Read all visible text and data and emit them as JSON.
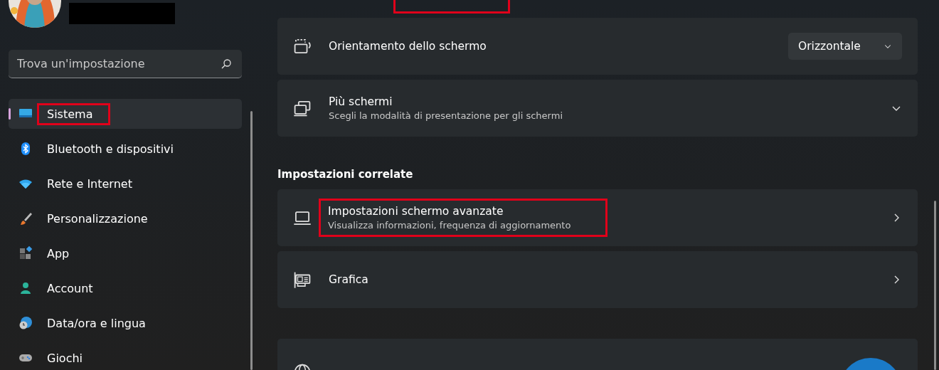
{
  "user": {
    "name_redacted": true
  },
  "search": {
    "placeholder": "Trova un'impostazione"
  },
  "sidebar": {
    "items": [
      {
        "label": "Sistema",
        "selected": true,
        "highlighted": true
      },
      {
        "label": "Bluetooth e dispositivi",
        "selected": false,
        "highlighted": false
      },
      {
        "label": "Rete e Internet",
        "selected": false,
        "highlighted": false
      },
      {
        "label": "Personalizzazione",
        "selected": false,
        "highlighted": false
      },
      {
        "label": "App",
        "selected": false,
        "highlighted": false
      },
      {
        "label": "Account",
        "selected": false,
        "highlighted": false
      },
      {
        "label": "Data/ora e lingua",
        "selected": false,
        "highlighted": false
      },
      {
        "label": "Giochi",
        "selected": false,
        "highlighted": false
      }
    ]
  },
  "breadcrumb": {
    "current_highlighted": true
  },
  "settings": [
    {
      "kind": "dropdown",
      "title": "Orientamento dello schermo",
      "value": "Orizzontale",
      "highlighted": false
    },
    {
      "kind": "expander",
      "title": "Più schermi",
      "subtitle": "Scegli la modalità di presentazione per gli schermi",
      "highlighted": false
    }
  ],
  "related": {
    "heading": "Impostazioni correlate",
    "items": [
      {
        "kind": "link",
        "title": "Impostazioni schermo avanzate",
        "subtitle": "Visualizza informazioni, frequenza di aggiornamento",
        "highlighted": true
      },
      {
        "kind": "link",
        "title": "Grafica",
        "highlighted": false
      }
    ]
  },
  "bottom_card": {
    "kind": "card"
  }
}
